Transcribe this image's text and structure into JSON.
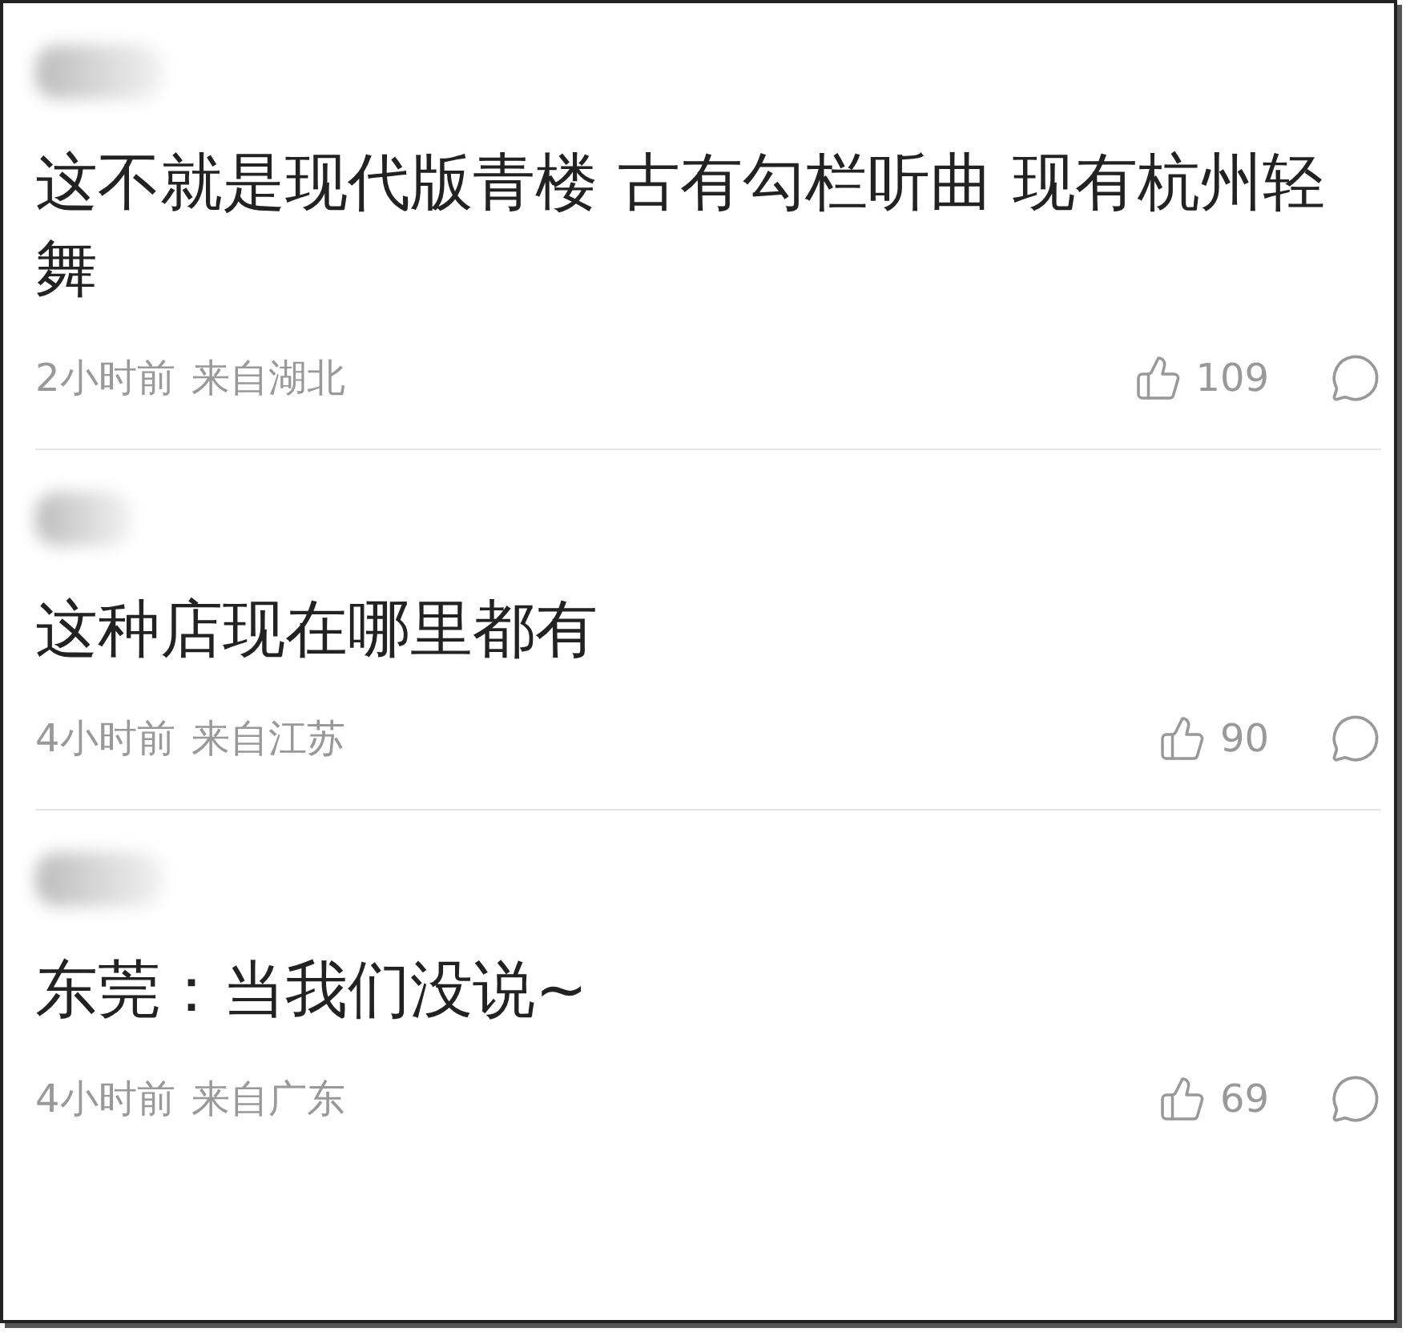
{
  "comments": [
    {
      "text": "这不就是现代版青楼 古有勾栏听曲 现有杭州轻舞",
      "time": "2小时前",
      "location": "来自湖北",
      "likes": "109"
    },
    {
      "text": "这种店现在哪里都有",
      "time": "4小时前",
      "location": "来自江苏",
      "likes": "90"
    },
    {
      "text": "东莞：当我们没说~",
      "time": "4小时前",
      "location": "来自广东",
      "likes": "69"
    }
  ]
}
